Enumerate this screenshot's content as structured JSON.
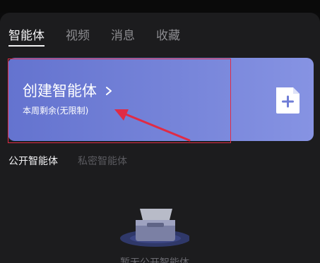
{
  "tabs": [
    {
      "label": "智能体",
      "active": true
    },
    {
      "label": "视频",
      "active": false
    },
    {
      "label": "消息",
      "active": false
    },
    {
      "label": "收藏",
      "active": false
    }
  ],
  "create_card": {
    "title": "创建智能体",
    "subtitle": "本周剩余(无限制)",
    "icon": "document-plus-icon"
  },
  "subtabs": [
    {
      "label": "公开智能体",
      "active": true
    },
    {
      "label": "私密智能体",
      "active": false
    }
  ],
  "empty_state": {
    "icon": "empty-box-icon",
    "text": "暂无公开智能体"
  },
  "colors": {
    "card_gradient_start": "#6473cf",
    "card_gradient_end": "#8693e3",
    "annotation_red": "#e02b45",
    "background": "#1c1c1e"
  }
}
